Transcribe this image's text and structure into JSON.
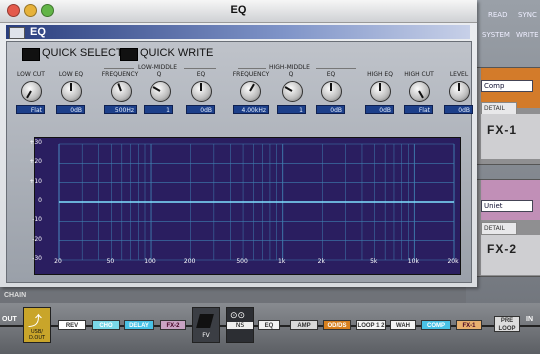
{
  "window": {
    "title": "EQ",
    "panel_title": "EQ"
  },
  "quick": {
    "select_label": "QUICK SELECT",
    "write_label": "QUICK WRITE"
  },
  "groups": {
    "low_middle": "LOW-MIDDLE",
    "high_middle": "HIGH-MIDDLE"
  },
  "params": [
    {
      "label": "LOW CUT",
      "value": "Flat"
    },
    {
      "label": "LOW EQ",
      "value": "0dB"
    },
    {
      "label": "FREQUENCY",
      "value": "500Hz"
    },
    {
      "label": "Q",
      "value": "1"
    },
    {
      "label": "EQ",
      "value": "0dB"
    },
    {
      "label": "FREQUENCY",
      "value": "4.00kHz"
    },
    {
      "label": "Q",
      "value": "1"
    },
    {
      "label": "EQ",
      "value": "0dB"
    },
    {
      "label": "HIGH EQ",
      "value": "0dB"
    },
    {
      "label": "HIGH CUT",
      "value": "Flat"
    },
    {
      "label": "LEVEL",
      "value": "0dB"
    }
  ],
  "graph": {
    "y_ticks": [
      "+30",
      "+20",
      "+10",
      "0",
      "-10",
      "-20",
      "-30"
    ],
    "x_ticks": [
      "20",
      "50",
      "100",
      "200",
      "500",
      "1k",
      "2k",
      "5k",
      "10k",
      "20k"
    ],
    "curve_db": 0
  },
  "right": {
    "tabs": [
      "READ",
      "SYNC",
      "SYSTEM",
      "WRITE"
    ],
    "fx1": {
      "select": "Comp",
      "detail": "DETAIL",
      "name": "FX-1"
    },
    "fx2": {
      "select": "Uniet",
      "detail": "DETAIL",
      "name": "FX-2"
    }
  },
  "chain": {
    "label": "CHAIN",
    "out_label": "OUT",
    "in_label": "IN",
    "usb_label": "USB/ D.OUT",
    "fv_label": "FV",
    "ns_label": "NS",
    "blocks": [
      "REV",
      "CHO",
      "DELAY",
      "FX-2",
      "EQ",
      "AMP",
      "OD/DS",
      "LOOP 1 2",
      "WAH",
      "COMP",
      "FX-1",
      "PRE LOOP"
    ]
  }
}
